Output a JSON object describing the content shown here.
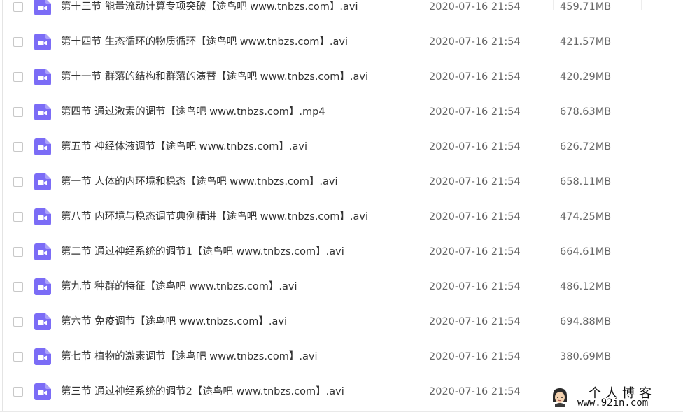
{
  "file_list": {
    "icon_color": "#7b6cf6",
    "rows": [
      {
        "name": "第十三节 能量流动计算专项突破【途鸟吧 www.tnbzs.com】.avi",
        "date": "2020-07-16 21:54",
        "size": "459.71MB"
      },
      {
        "name": "第十四节 生态循环的物质循环【途鸟吧 www.tnbzs.com】.avi",
        "date": "2020-07-16 21:54",
        "size": "421.57MB"
      },
      {
        "name": "第十一节 群落的结构和群落的演替【途鸟吧 www.tnbzs.com】.avi",
        "date": "2020-07-16 21:54",
        "size": "420.29MB"
      },
      {
        "name": "第四节 通过激素的调节【途鸟吧 www.tnbzs.com】.mp4",
        "date": "2020-07-16 21:54",
        "size": "678.63MB"
      },
      {
        "name": "第五节 神经体液调节【途鸟吧 www.tnbzs.com】.avi",
        "date": "2020-07-16 21:54",
        "size": "626.72MB"
      },
      {
        "name": "第一节 人体的内环境和稳态【途鸟吧 www.tnbzs.com】.avi",
        "date": "2020-07-16 21:54",
        "size": "658.11MB"
      },
      {
        "name": "第八节 内环境与稳态调节典例精讲【途鸟吧 www.tnbzs.com】.avi",
        "date": "2020-07-16 21:54",
        "size": "474.25MB"
      },
      {
        "name": "第二节 通过神经系统的调节1【途鸟吧 www.tnbzs.com】.avi",
        "date": "2020-07-16 21:54",
        "size": "664.61MB"
      },
      {
        "name": "第九节 种群的特征【途鸟吧 www.tnbzs.com】.avi",
        "date": "2020-07-16 21:54",
        "size": "486.12MB"
      },
      {
        "name": "第六节 免疫调节【途鸟吧 www.tnbzs.com】.avi",
        "date": "2020-07-16 21:54",
        "size": "694.88MB"
      },
      {
        "name": "第七节 植物的激素调节【途鸟吧 www.tnbzs.com】.avi",
        "date": "2020-07-16 21:54",
        "size": "380.69MB"
      },
      {
        "name": "第三节 通过神经系统的调节2【途鸟吧 www.tnbzs.com】.avi",
        "date": "2020-07-16 21:54",
        "size": ""
      }
    ]
  },
  "watermark": {
    "title": "个人博客",
    "url": "www.92in.com"
  }
}
